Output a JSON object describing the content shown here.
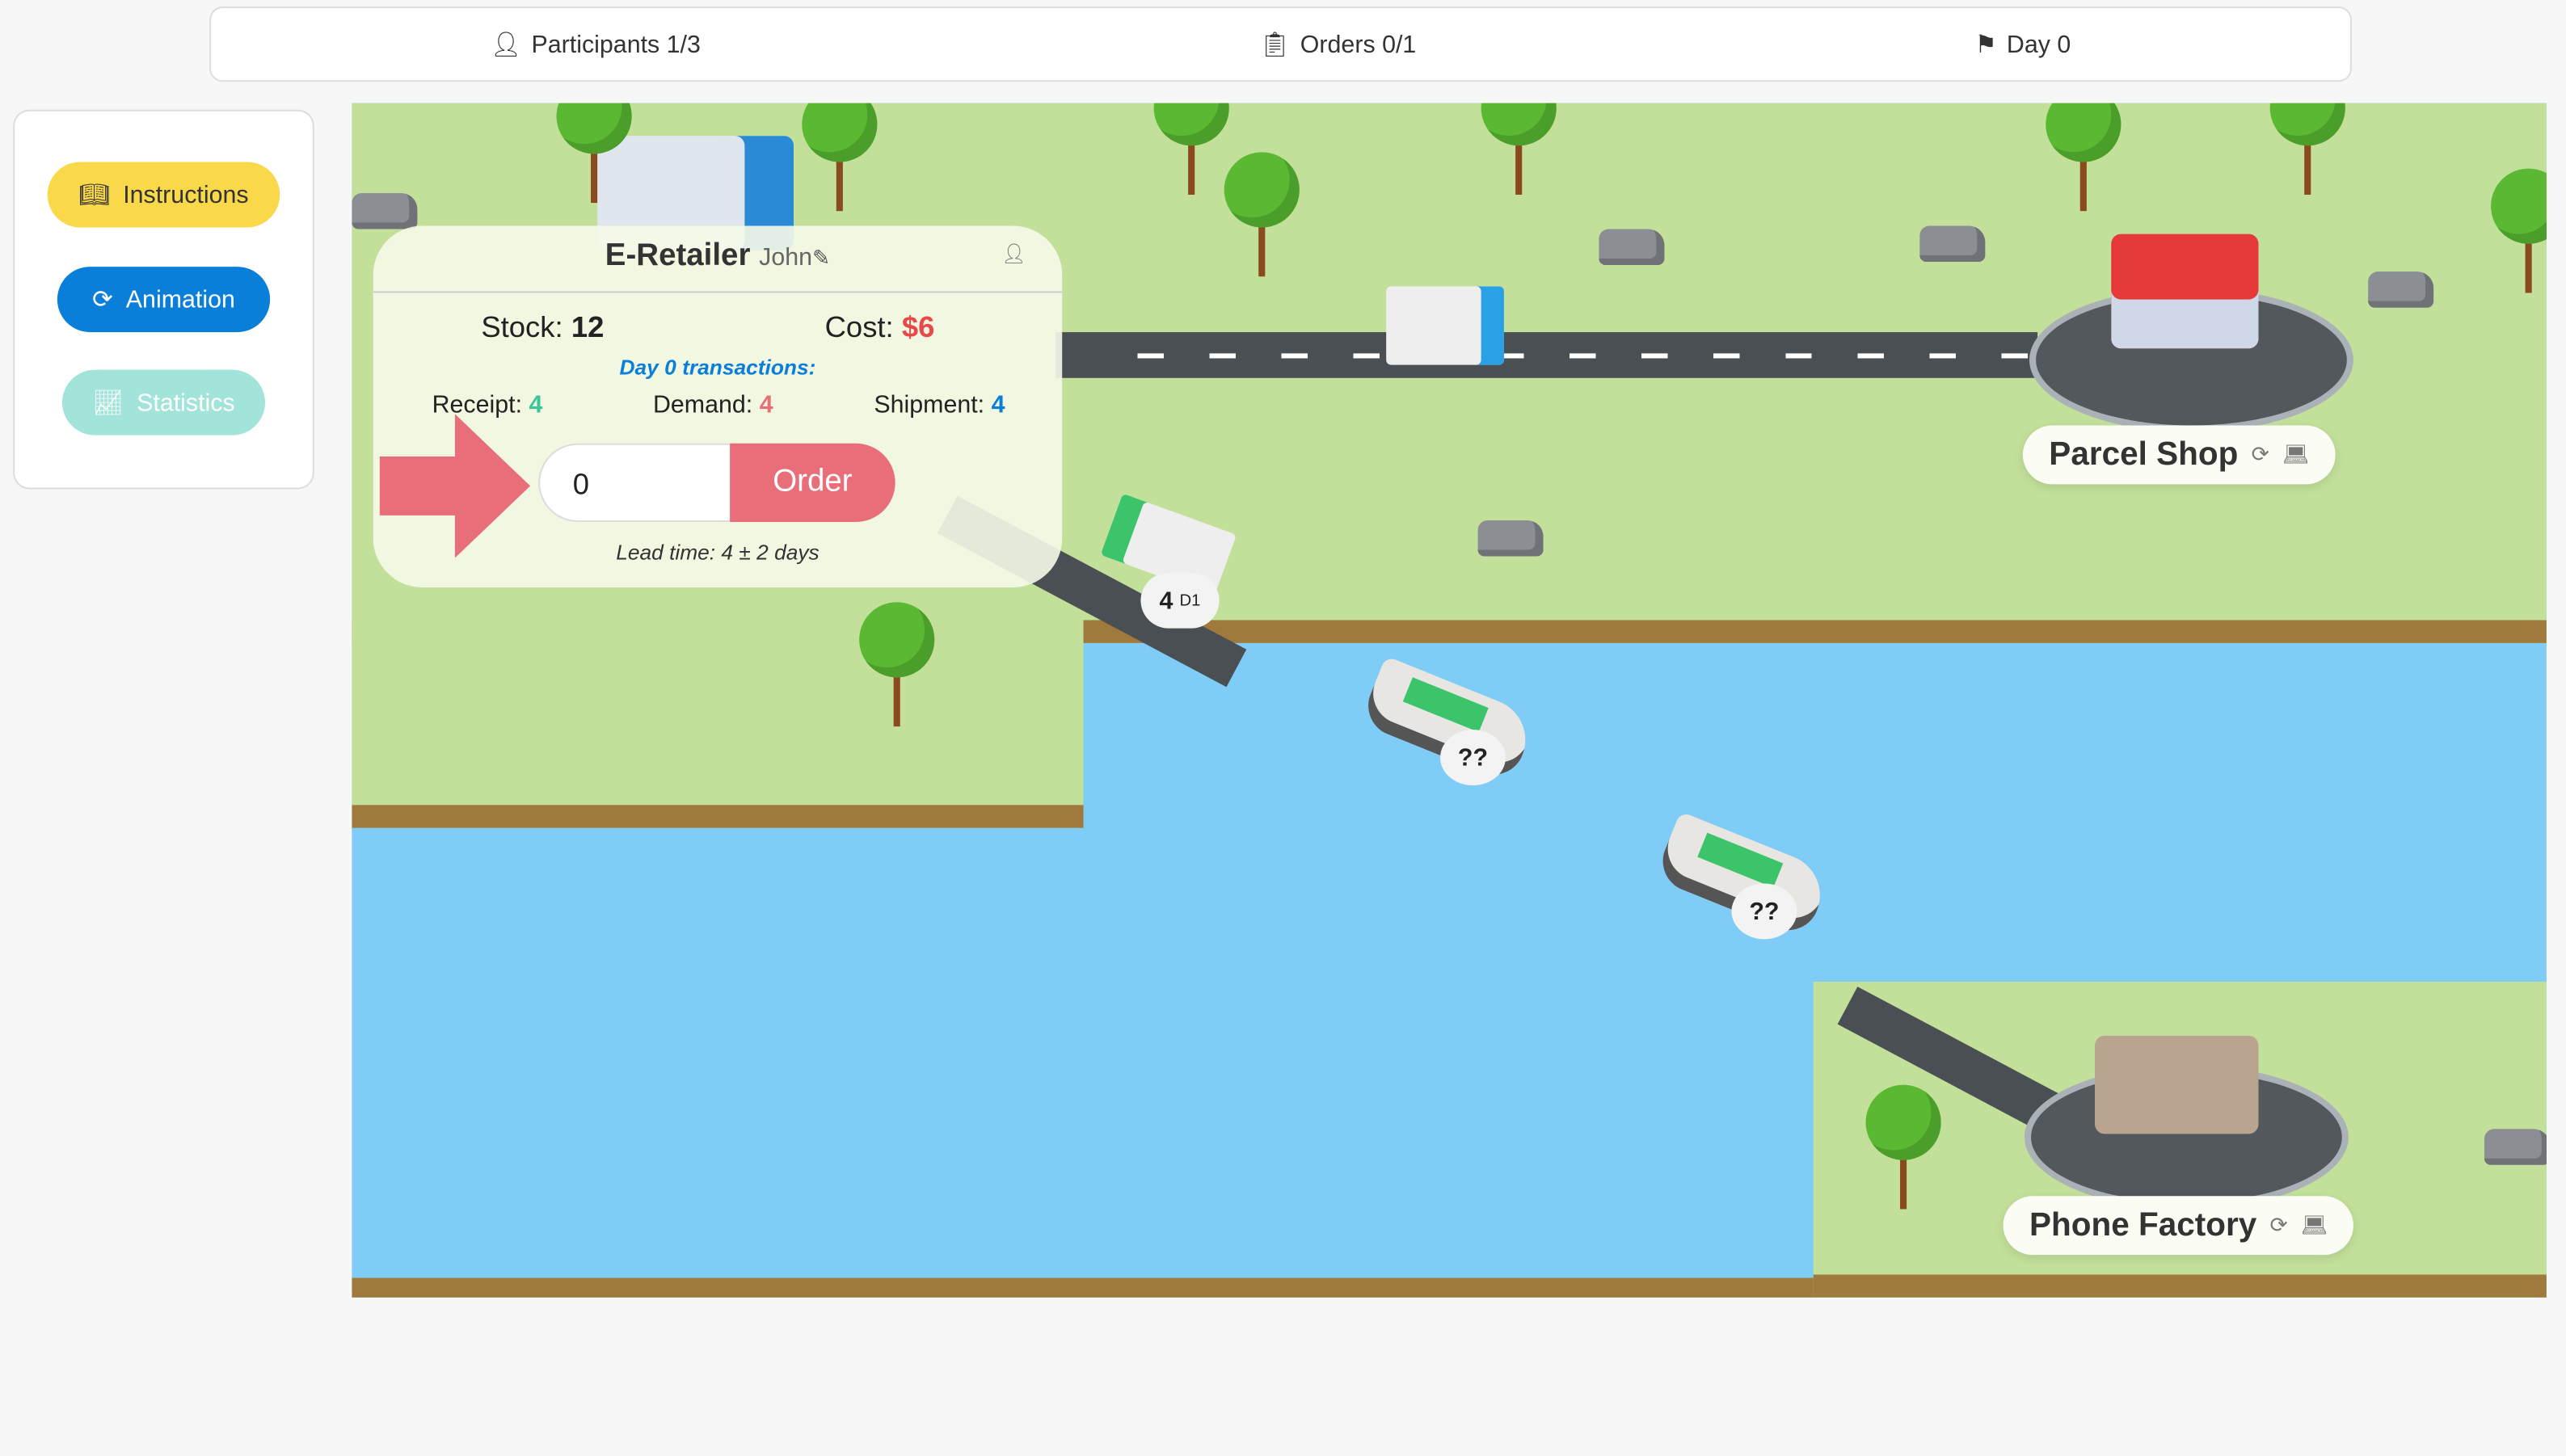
{
  "topbar": {
    "participants": "Participants 1/3",
    "orders": "Orders 0/1",
    "day": "Day 0"
  },
  "sidebar": {
    "instructions": "Instructions",
    "animation": "Animation",
    "statistics": "Statistics"
  },
  "colors": {
    "instructions": "#f9d84a",
    "animation": "#0a7fd9",
    "statistics": "#a3e4da",
    "order": "#e86e79",
    "land": "#c2e09a",
    "water": "#7fcdf6"
  },
  "card": {
    "role": "E-Retailer",
    "player": "John",
    "stock_label": "Stock:",
    "stock": "12",
    "cost_label": "Cost:",
    "cost": "$6",
    "transactions_title": "Day 0 transactions:",
    "receipt_label": "Receipt:",
    "receipt": "4",
    "demand_label": "Demand:",
    "demand": "4",
    "shipment_label": "Shipment:",
    "shipment": "4",
    "order_value": "0",
    "order_button": "Order",
    "lead_time": "Lead time: 4 ± 2 days"
  },
  "map": {
    "parcel_shop": "Parcel Shop",
    "phone_factory": "Phone Factory",
    "truck_badge_qty": "4",
    "truck_badge_day": "D1",
    "ship1_badge": "??",
    "ship2_badge": "??"
  }
}
